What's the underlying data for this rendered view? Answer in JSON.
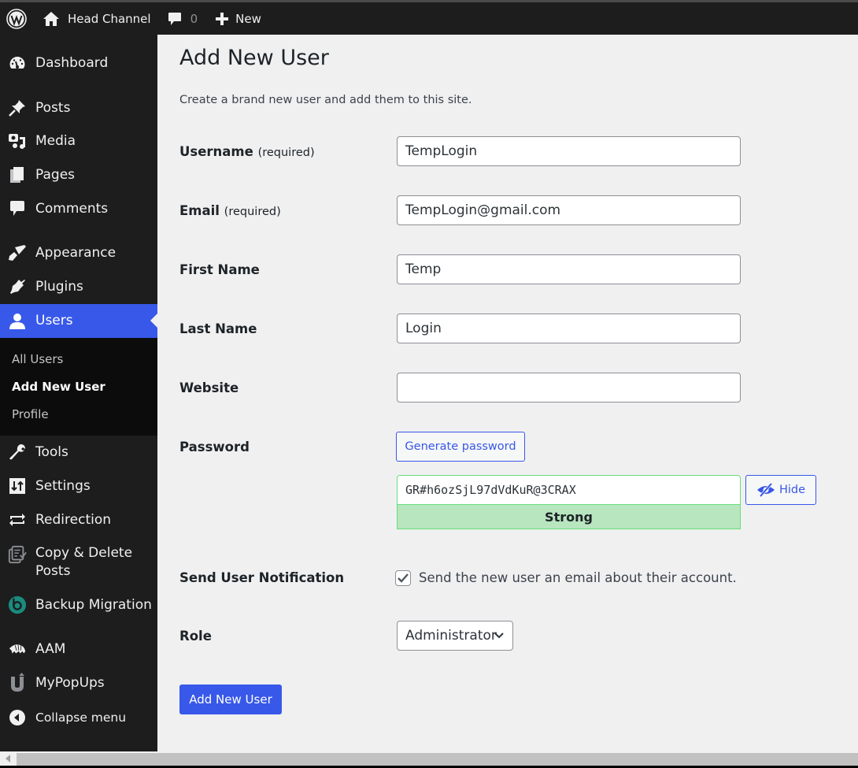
{
  "admin_bar": {
    "site_name": "Head Channel",
    "comments_count": "0",
    "new_label": "New"
  },
  "sidebar": {
    "items": [
      {
        "label": "Dashboard",
        "icon": "dashboard-icon"
      },
      {
        "label": "Posts",
        "icon": "pin-icon"
      },
      {
        "label": "Media",
        "icon": "media-icon"
      },
      {
        "label": "Pages",
        "icon": "pages-icon"
      },
      {
        "label": "Comments",
        "icon": "comment-icon"
      },
      {
        "label": "Appearance",
        "icon": "paintbrush-icon"
      },
      {
        "label": "Plugins",
        "icon": "plugin-icon"
      },
      {
        "label": "Users",
        "icon": "user-icon",
        "active": true
      },
      {
        "label": "Tools",
        "icon": "wrench-icon"
      },
      {
        "label": "Settings",
        "icon": "settings-icon"
      },
      {
        "label": "Redirection",
        "icon": "redirect-icon"
      },
      {
        "label": "Copy & Delete Posts",
        "label_line1": "Copy & Delete",
        "label_line2": "Posts",
        "icon": "copy-delete-icon"
      },
      {
        "label": "Backup Migration",
        "icon": "backup-icon"
      },
      {
        "label": "AAM",
        "icon": "armadillo-icon"
      },
      {
        "label": "MyPopUps",
        "icon": "mypopups-icon"
      },
      {
        "label": "Collapse menu",
        "icon": "collapse-icon"
      }
    ],
    "submenu": [
      {
        "label": "All Users"
      },
      {
        "label": "Add New User",
        "current": true
      },
      {
        "label": "Profile"
      }
    ]
  },
  "page": {
    "title": "Add New User",
    "intro": "Create a brand new user and add them to this site.",
    "required_suffix": "(required)",
    "fields": {
      "username": {
        "label": "Username",
        "value": "TempLogin"
      },
      "email": {
        "label": "Email",
        "value": "TempLogin@gmail.com"
      },
      "first_name": {
        "label": "First Name",
        "value": "Temp"
      },
      "last_name": {
        "label": "Last Name",
        "value": "Login"
      },
      "website": {
        "label": "Website",
        "value": ""
      },
      "password": {
        "label": "Password",
        "generate_label": "Generate password",
        "value": "GR#h6ozSjL97dVdKuR@3CRAX",
        "hide_label": "Hide",
        "strength": "Strong"
      },
      "notification": {
        "label": "Send User Notification",
        "checked": true,
        "text": "Send the new user an email about their account."
      },
      "role": {
        "label": "Role",
        "value": "Administrator"
      }
    },
    "submit_label": "Add New User"
  },
  "colors": {
    "accent": "#3858e9",
    "adminbar_bg": "#1d1d1d",
    "submenu_bg": "#0c0c0c",
    "content_bg": "#f0f0f1",
    "strength_bg": "#b8e6bf",
    "strength_border": "#68de7c"
  }
}
